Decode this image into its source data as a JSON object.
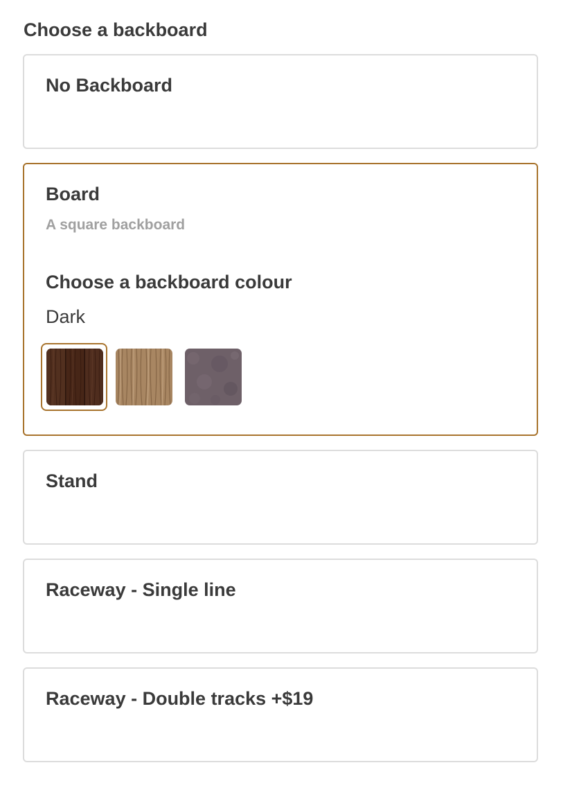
{
  "section_title": "Choose a backboard",
  "options": [
    {
      "title": "No Backboard",
      "selected": false
    },
    {
      "title": "Board",
      "description": "A square backboard",
      "selected": true,
      "colour_heading": "Choose a backboard colour",
      "selected_colour": "Dark",
      "swatches": [
        {
          "name": "Dark",
          "color": "#4a2a1c",
          "selected": true
        },
        {
          "name": "Light wood",
          "color": "#a88662",
          "selected": false
        },
        {
          "name": "Grey",
          "color": "#6e6068",
          "selected": false
        }
      ]
    },
    {
      "title": "Stand",
      "selected": false
    },
    {
      "title": "Raceway - Single line",
      "selected": false
    },
    {
      "title": "Raceway - Double tracks +$19",
      "selected": false
    }
  ],
  "colors": {
    "accent": "#a8732c",
    "border": "#dcdcdc",
    "text": "#3a3a3a",
    "muted": "#a0a0a0"
  }
}
